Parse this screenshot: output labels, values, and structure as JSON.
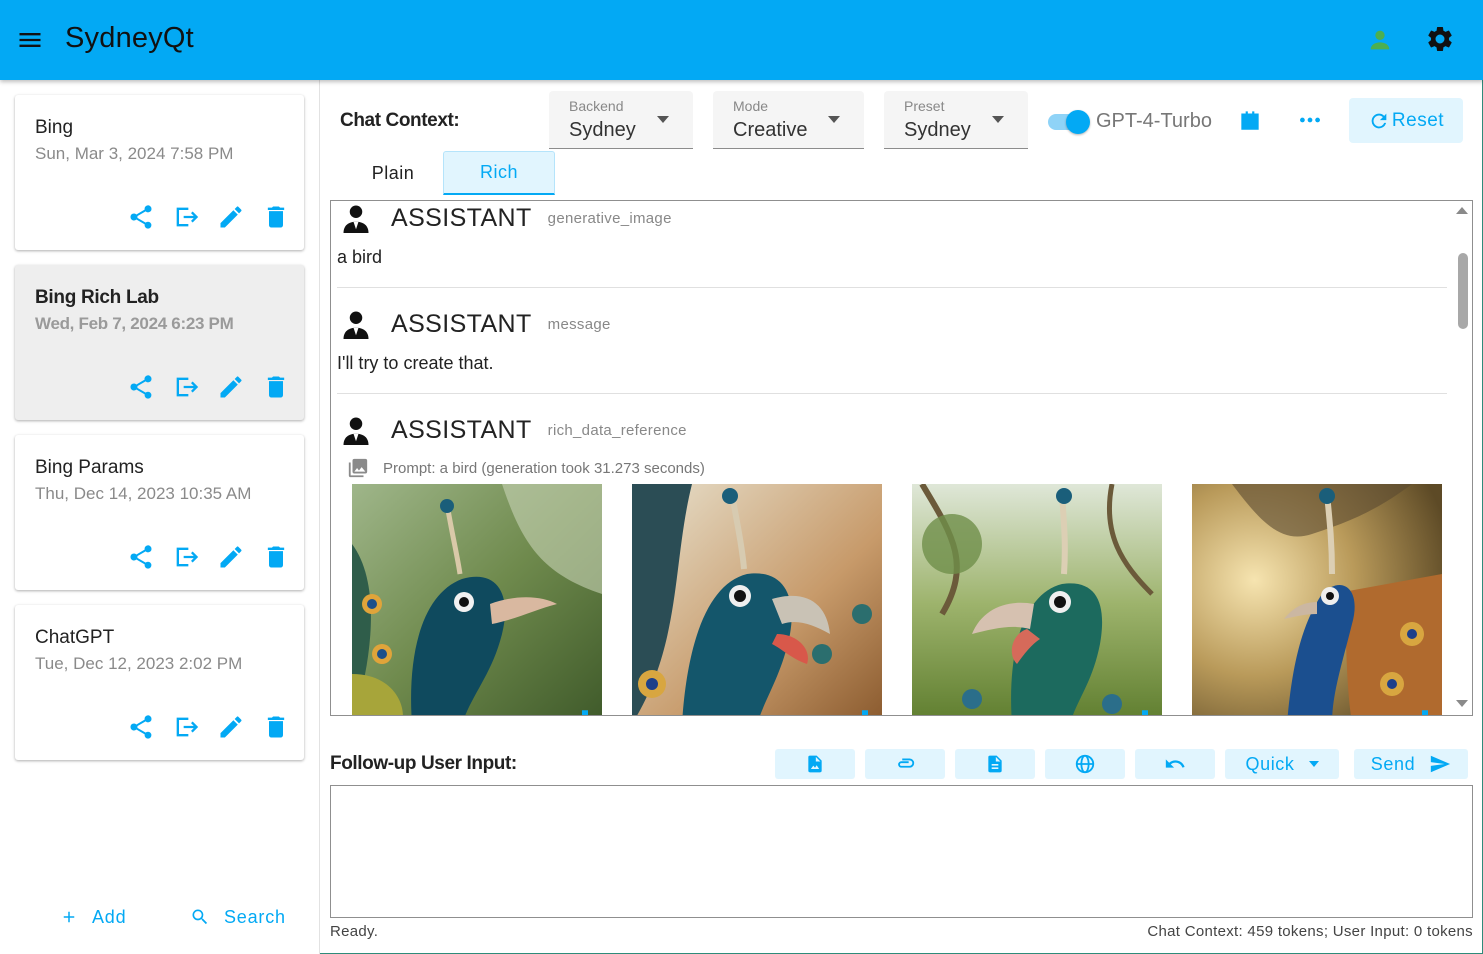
{
  "app": {
    "title": "SydneyQt",
    "accent_color": "#03a9f4"
  },
  "topbar": {
    "menu_icon": "hamburger-menu-icon",
    "user_icon": "person-icon",
    "settings_icon": "gear-icon"
  },
  "sidebar": {
    "items": [
      {
        "title": "Bing",
        "date": "Sun, Mar 3, 2024 7:58 PM"
      },
      {
        "title": "Bing Rich Lab",
        "date": "Wed, Feb 7, 2024 6:23 PM",
        "active": true
      },
      {
        "title": "Bing Params",
        "date": "Thu, Dec 14, 2023 10:35 AM"
      },
      {
        "title": "ChatGPT",
        "date": "Tue, Dec 12, 2023 2:02 PM"
      }
    ],
    "item_actions": [
      "share-icon",
      "export-icon",
      "edit-icon",
      "delete-icon"
    ],
    "add_label": "Add",
    "search_label": "Search"
  },
  "header": {
    "context_label": "Chat Context:",
    "backend": {
      "label": "Backend",
      "value": "Sydney"
    },
    "mode": {
      "label": "Mode",
      "value": "Creative"
    },
    "preset": {
      "label": "Preset",
      "value": "Sydney"
    },
    "gpt4_toggle": {
      "label": "GPT-4-Turbo",
      "on": true
    },
    "reset_label": "Reset"
  },
  "tabs": [
    {
      "label": "Plain",
      "active": false
    },
    {
      "label": "Rich",
      "active": true
    }
  ],
  "chat": {
    "messages": [
      {
        "role": "ASSISTANT",
        "type": "generative_image",
        "text": "a bird"
      },
      {
        "role": "ASSISTANT",
        "type": "message",
        "text": "I'll try to create that."
      },
      {
        "role": "ASSISTANT",
        "type": "rich_data_reference",
        "prompt": "Prompt: a bird (generation took 31.273 seconds)"
      }
    ],
    "images": [
      "peacock-image-1",
      "peacock-image-2",
      "peacock-image-3",
      "peacock-image-4"
    ]
  },
  "input": {
    "label": "Follow-up User Input:",
    "value": "",
    "toolbar_icons": [
      "image-file-icon",
      "attachment-icon",
      "document-icon",
      "globe-icon",
      "undo-icon"
    ],
    "quick_label": "Quick",
    "send_label": "Send"
  },
  "status": {
    "left": "Ready.",
    "right": "Chat Context: 459 tokens; User Input: 0 tokens"
  }
}
